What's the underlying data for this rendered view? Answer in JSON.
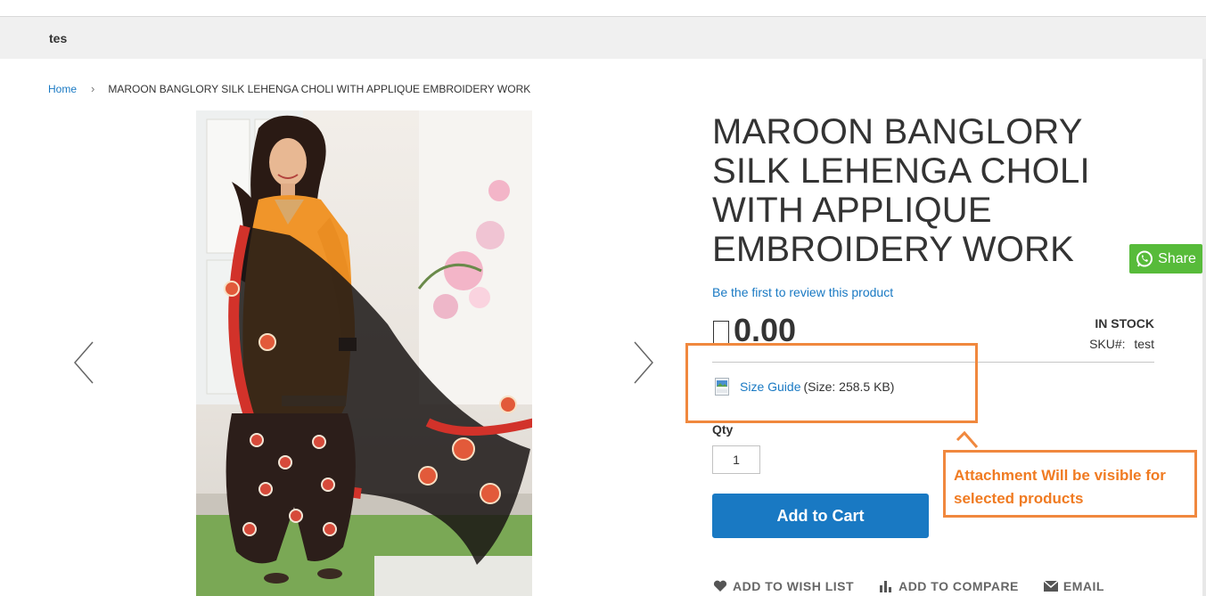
{
  "nav": {
    "item": "tes"
  },
  "breadcrumb": {
    "home": "Home",
    "current": "MAROON BANGLORY SILK LEHENGA CHOLI WITH APPLIQUE EMBROIDERY WORK"
  },
  "product": {
    "title": "MAROON BANGLORY SILK LEHENGA CHOLI WITH APPLIQUE EMBROIDERY WORK",
    "review_link": "Be the first to review this product",
    "price": "0.00",
    "stock": "In stock",
    "sku_label": "SKU#:",
    "sku_value": "test",
    "attachment_name": "Size Guide",
    "attachment_size": "(Size: 258.5 KB)",
    "qty_label": "Qty",
    "qty_value": "1",
    "add_to_cart": "Add to Cart"
  },
  "actions": {
    "wishlist": "Add to Wish List",
    "compare": "Add to Compare",
    "email": "Email"
  },
  "share": {
    "label": "Share"
  },
  "annotation": {
    "note": "Attachment Will be visible for selected products",
    "color": "#f0883e"
  },
  "colors": {
    "link": "#1979c3",
    "button": "#1979c3",
    "share": "#57bb3a"
  }
}
